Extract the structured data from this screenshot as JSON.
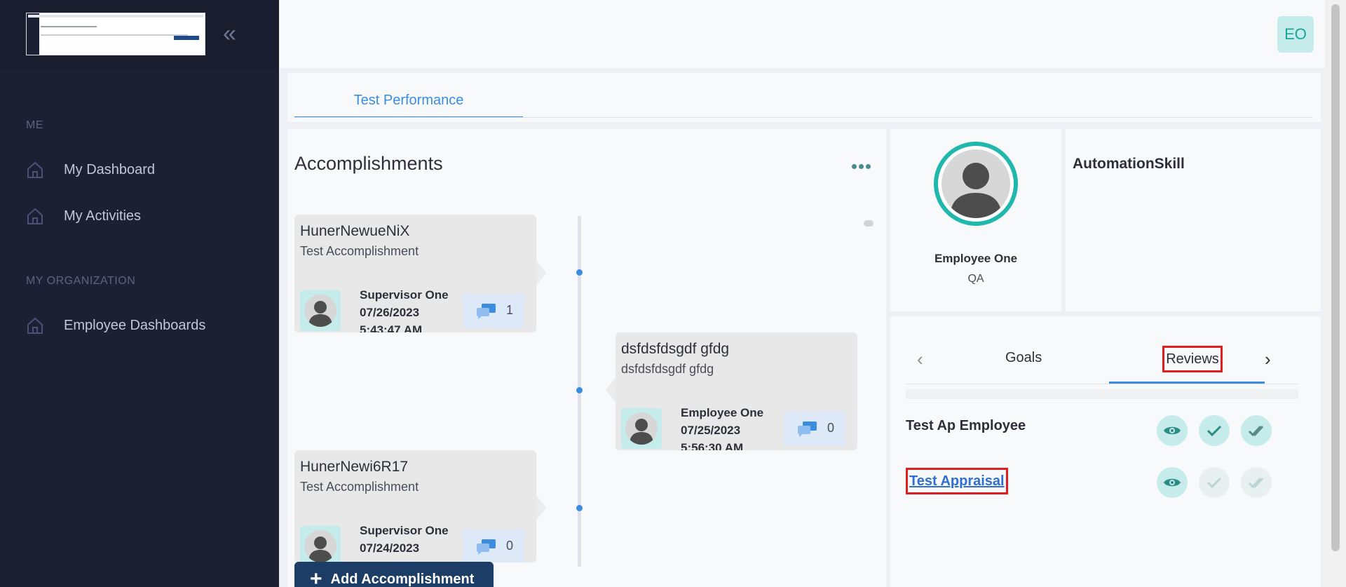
{
  "sidebar": {
    "sections": [
      {
        "label": "ME"
      },
      {
        "label": "MY ORGANIZATION"
      }
    ],
    "items": [
      {
        "label": "My Dashboard",
        "icon": "home-icon"
      },
      {
        "label": "My Activities",
        "icon": "home-icon"
      },
      {
        "label": "Employee Dashboards",
        "icon": "home-icon"
      }
    ]
  },
  "header": {
    "user_initials": "EO"
  },
  "tabs": [
    {
      "label": "Test Performance",
      "active": true
    }
  ],
  "accomplishments": {
    "title": "Accomplishments",
    "cards": [
      {
        "name": "HunerNewueNiX",
        "subtitle": "Test Accomplishment",
        "person": "Supervisor One",
        "date": "07/26/2023",
        "time": "5:43:47 AM",
        "comments": "1"
      },
      {
        "name": "dsfdsfdsgdf gfdg",
        "subtitle": "dsfdsfdsgdf gfdg",
        "person": "Employee One",
        "date": "07/25/2023",
        "time": "5:56:30 AM",
        "comments": "0"
      },
      {
        "name": "HunerNewi6R17",
        "subtitle": "Test Accomplishment",
        "person": "Supervisor One",
        "date": "07/24/2023",
        "time": "",
        "comments": "0"
      }
    ],
    "add_button": "Add Accomplishment"
  },
  "profile": {
    "name": "Employee One",
    "role": "QA"
  },
  "skill": {
    "title": "AutomationSkill"
  },
  "reviews": {
    "tabs": [
      {
        "label": "Goals"
      },
      {
        "label": "Reviews",
        "active": true
      }
    ],
    "rows": [
      {
        "name": "Test Ap Employee",
        "is_link": false
      },
      {
        "name": "Test Appraisal",
        "is_link": true
      }
    ]
  },
  "colors": {
    "sidebar_bg": "#1c2033",
    "accent_blue": "#3b8de0",
    "teal": "#20b7ad",
    "button_dark": "#1c3e66",
    "highlight_red": "#e01e1e"
  }
}
